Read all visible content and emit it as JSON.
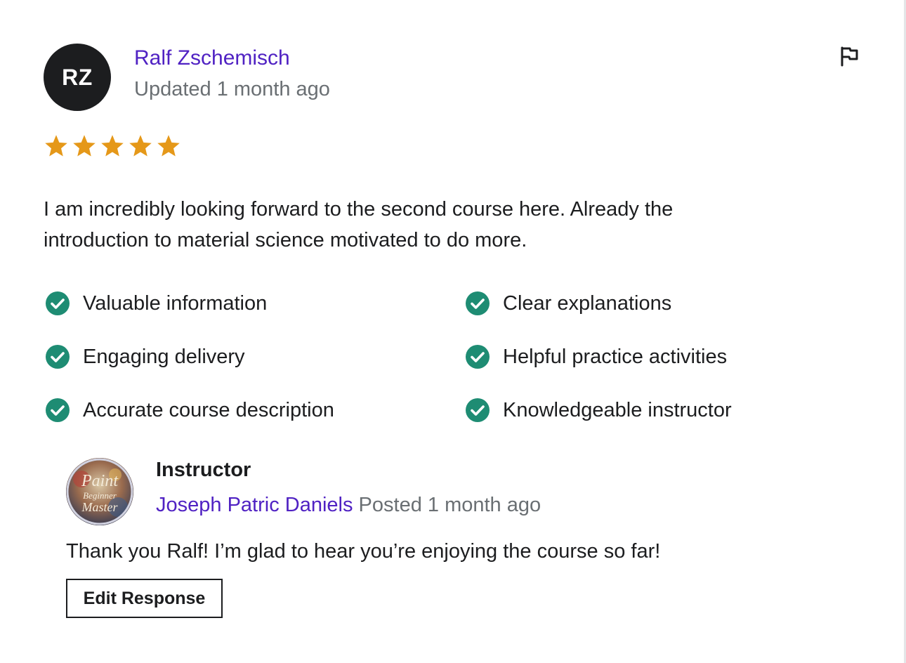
{
  "reviewer": {
    "initials": "RZ",
    "name": "Ralf Zschemisch",
    "updated": "Updated 1 month ago"
  },
  "rating": {
    "value": 5,
    "max": 5,
    "color": "#e59819"
  },
  "review": {
    "text": "I am incredibly looking forward to the second course here. Already the introduction to material science motivated to do more."
  },
  "feedback_tags": [
    "Valuable information",
    "Clear explanations",
    "Engaging delivery",
    "Helpful practice activities",
    "Accurate course description",
    "Knowledgeable instructor"
  ],
  "response": {
    "role": "Instructor",
    "name": "Joseph Patric Daniels",
    "posted": "Posted 1 month ago",
    "text": "Thank you Ralf! I’m glad to hear you’re enjoying the course so far!",
    "avatar_text": [
      "Paint",
      "Beginner",
      "Master"
    ],
    "edit_label": "Edit Response"
  },
  "icons": {
    "flag": "flag-icon",
    "star": "star-icon",
    "check": "check-circle-icon"
  },
  "colors": {
    "link": "#5022c3",
    "muted": "#6a6f73",
    "check": "#1e8c73",
    "star": "#e59819"
  }
}
